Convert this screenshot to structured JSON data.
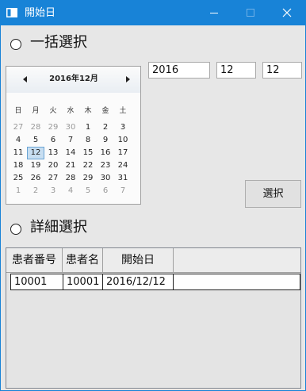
{
  "window": {
    "title": "開始日",
    "controls": [
      "minimize-icon",
      "maximize-icon",
      "close-icon"
    ]
  },
  "bulk": {
    "label": "一括選択",
    "selected": false
  },
  "calendar": {
    "month_label": "2016年12月",
    "weekdays": [
      "日",
      "月",
      "火",
      "水",
      "木",
      "金",
      "土"
    ],
    "weeks": [
      [
        "27",
        "28",
        "29",
        "30",
        "1",
        "2",
        "3"
      ],
      [
        "4",
        "5",
        "6",
        "7",
        "8",
        "9",
        "10"
      ],
      [
        "11",
        "12",
        "13",
        "14",
        "15",
        "16",
        "17"
      ],
      [
        "18",
        "19",
        "20",
        "21",
        "22",
        "23",
        "24"
      ],
      [
        "25",
        "26",
        "27",
        "28",
        "29",
        "30",
        "31"
      ],
      [
        "1",
        "2",
        "3",
        "4",
        "5",
        "6",
        "7"
      ]
    ],
    "other_month_flags": [
      [
        true,
        true,
        true,
        true,
        false,
        false,
        false
      ],
      [
        false,
        false,
        false,
        false,
        false,
        false,
        false
      ],
      [
        false,
        false,
        false,
        false,
        false,
        false,
        false
      ],
      [
        false,
        false,
        false,
        false,
        false,
        false,
        false
      ],
      [
        false,
        false,
        false,
        false,
        false,
        false,
        false
      ],
      [
        true,
        true,
        true,
        true,
        true,
        true,
        true
      ]
    ],
    "selected_day": "12",
    "prev_icon": "prev-month-icon",
    "next_icon": "next-month-icon"
  },
  "date_fields": {
    "year": "2016",
    "month": "12",
    "day": "12"
  },
  "select_button": "選択",
  "detail": {
    "label": "詳細選択",
    "selected": false
  },
  "grid": {
    "columns": [
      "患者番号",
      "患者名",
      "開始日"
    ],
    "rows": [
      [
        "10001",
        "10001",
        "2016/12/12"
      ]
    ]
  },
  "colors": {
    "titlebar": "#1883d7",
    "background": "#e7e7e7",
    "selected_day": "#c7def1"
  }
}
